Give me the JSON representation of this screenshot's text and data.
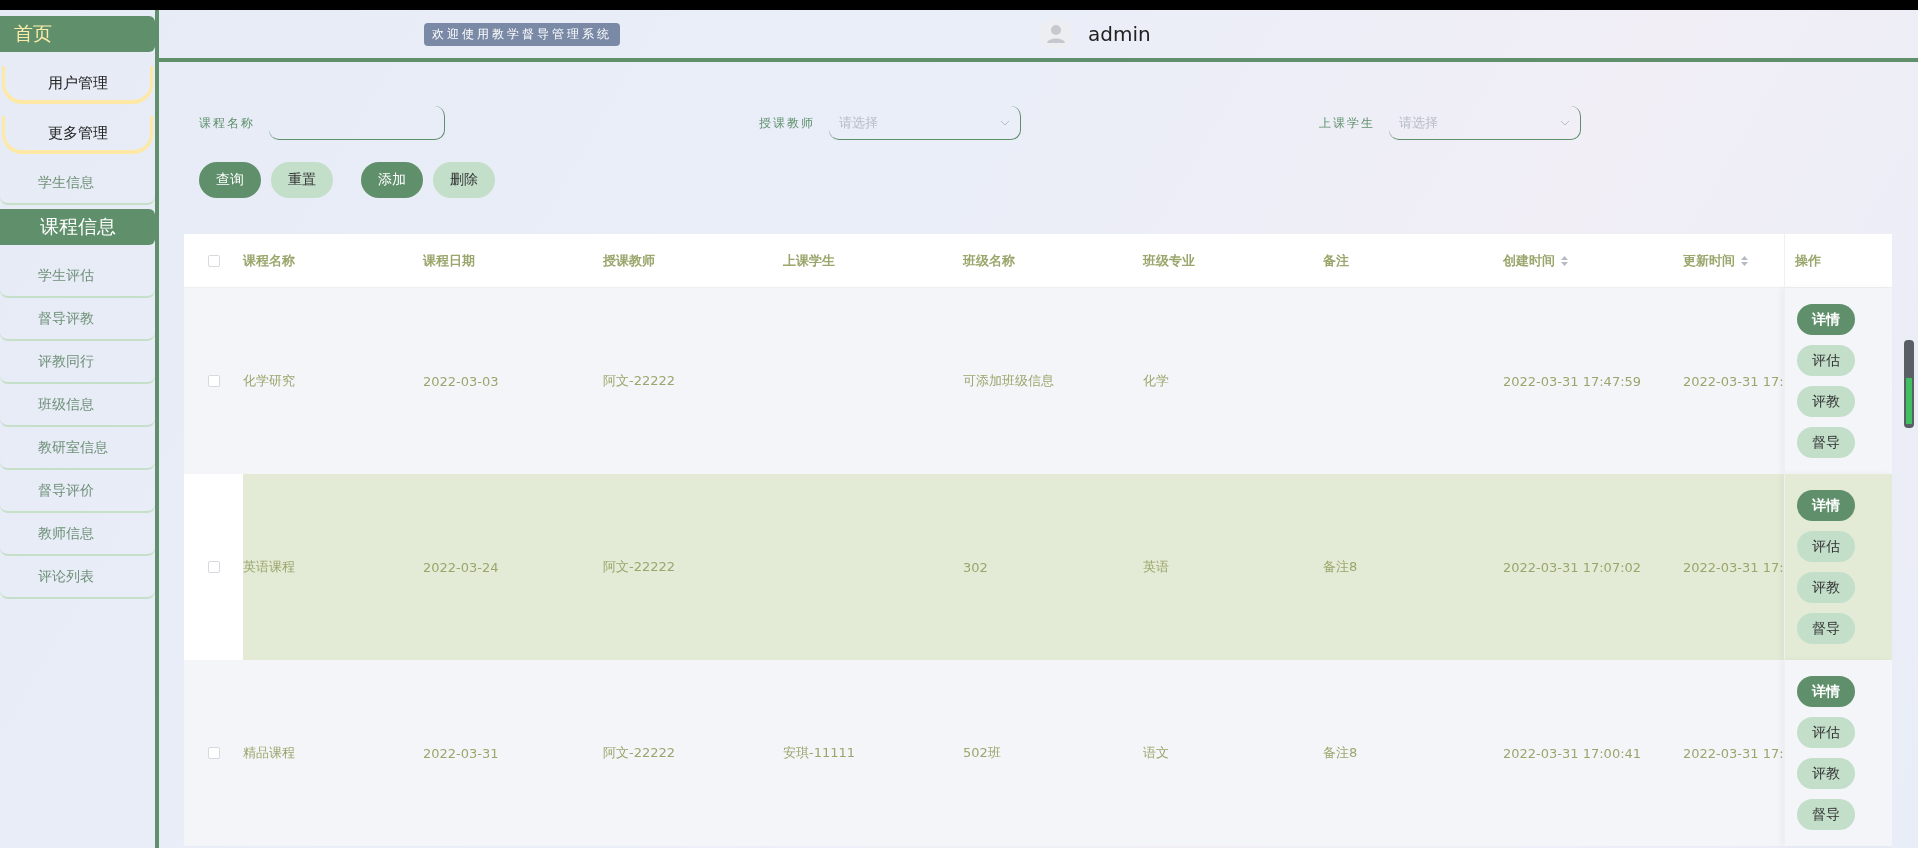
{
  "header": {
    "title": "欢迎使用教学督导管理系统",
    "user": "admin"
  },
  "sidebar": {
    "items": [
      {
        "kind": "header",
        "label": "首页"
      },
      {
        "kind": "menu",
        "label": "用户管理"
      },
      {
        "kind": "menu",
        "label": "更多管理"
      },
      {
        "kind": "item",
        "label": "学生信息"
      },
      {
        "kind": "header",
        "label": "课程信息"
      },
      {
        "kind": "item",
        "label": "学生评估"
      },
      {
        "kind": "item",
        "label": "督导评教"
      },
      {
        "kind": "item",
        "label": "评教同行"
      },
      {
        "kind": "item",
        "label": "班级信息"
      },
      {
        "kind": "item",
        "label": "教研室信息"
      },
      {
        "kind": "item",
        "label": "督导评价"
      },
      {
        "kind": "item",
        "label": "教师信息"
      },
      {
        "kind": "item",
        "label": "评论列表"
      }
    ]
  },
  "filters": [
    {
      "kind": "text",
      "label": "课程名称"
    },
    {
      "kind": "select",
      "label": "授课教师",
      "placeholder": "请选择"
    },
    {
      "kind": "select",
      "label": "上课学生",
      "placeholder": "请选择"
    }
  ],
  "buttons": [
    {
      "label": "查询",
      "primary": true
    },
    {
      "label": "重置",
      "primary": false
    },
    {
      "label": "添加",
      "primary": true
    },
    {
      "label": "删除",
      "primary": false
    }
  ],
  "table": {
    "columns": [
      {
        "label": "课程名称",
        "sortable": false
      },
      {
        "label": "课程日期",
        "sortable": false
      },
      {
        "label": "授课教师",
        "sortable": false
      },
      {
        "label": "上课学生",
        "sortable": false
      },
      {
        "label": "班级名称",
        "sortable": false
      },
      {
        "label": "班级专业",
        "sortable": false
      },
      {
        "label": "备注",
        "sortable": false
      },
      {
        "label": "创建时间",
        "sortable": true
      },
      {
        "label": "更新时间",
        "sortable": true
      }
    ],
    "action_column": "操作",
    "all_checked": false,
    "rows": [
      {
        "checked": false,
        "highlighted": false,
        "cells": [
          "化学研究",
          "2022-03-03",
          "阿文-22222",
          "",
          "可添加班级信息",
          "化学",
          "",
          "2022-03-31 17:47:59",
          "2022-03-31 17:"
        ],
        "actions": [
          {
            "label": "详情",
            "primary": true
          },
          {
            "label": "评估",
            "primary": false
          },
          {
            "label": "评教",
            "primary": false
          },
          {
            "label": "督导",
            "primary": false
          }
        ]
      },
      {
        "checked": false,
        "highlighted": true,
        "cells": [
          "英语课程",
          "2022-03-24",
          "阿文-22222",
          "",
          "302",
          "英语",
          "备注8",
          "2022-03-31 17:07:02",
          "2022-03-31 17:"
        ],
        "actions": [
          {
            "label": "详情",
            "primary": true
          },
          {
            "label": "评估",
            "primary": false
          },
          {
            "label": "评教",
            "primary": false
          },
          {
            "label": "督导",
            "primary": false
          }
        ]
      },
      {
        "checked": false,
        "highlighted": false,
        "cells": [
          "精品课程",
          "2022-03-31",
          "阿文-22222",
          "安琪-11111",
          "502班",
          "语文",
          "备注8",
          "2022-03-31 17:00:41",
          "2022-03-31 17:"
        ],
        "actions": [
          {
            "label": "详情",
            "primary": true
          },
          {
            "label": "评估",
            "primary": false
          },
          {
            "label": "评教",
            "primary": false
          },
          {
            "label": "督导",
            "primary": false
          }
        ]
      }
    ]
  }
}
